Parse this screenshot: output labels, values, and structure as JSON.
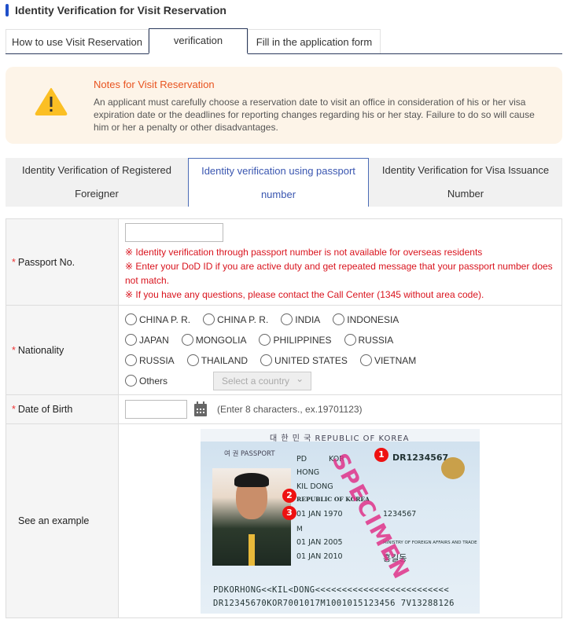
{
  "page_title": "Identity Verification for Visit Reservation",
  "tabs": [
    {
      "label": "How to use Visit Reservation"
    },
    {
      "label": "verification",
      "active": true
    },
    {
      "label": "Fill in the application form"
    }
  ],
  "notice": {
    "icon": "warning-icon",
    "title": "Notes for Visit Reservation",
    "body": "An applicant must carefully choose a reservation date to visit an office in consideration of his or her visa expiration date or the deadlines for reporting changes regarding his or her stay. Failure to do so will cause him or her a penalty or other disadvantages."
  },
  "subtabs": [
    {
      "line1": "Identity Verification of Registered",
      "line2": "Foreigner"
    },
    {
      "line1": "Identity verification using passport",
      "line2": "number",
      "active": true
    },
    {
      "line1": "Identity Verification for Visa Issuance",
      "line2": "Number"
    }
  ],
  "form": {
    "required_mark": "*",
    "passport": {
      "label": "Passport No.",
      "value": "",
      "notes": [
        "※ Identity verification through passport number is not available for overseas residents",
        "※ Enter your DoD ID if you are active duty and get repeated message that your passport number does not match.",
        "※ If you have any questions, please contact the Call Center (1345 without area code)."
      ]
    },
    "nationality": {
      "label": "Nationality",
      "rows": [
        [
          "CHINA P. R.",
          "CHINA P. R.",
          "INDIA",
          "INDONESIA"
        ],
        [
          "JAPAN",
          "MONGOLIA",
          "PHILIPPINES",
          "RUSSIA"
        ],
        [
          "RUSSIA",
          "THAILAND",
          "UNITED STATES",
          "VIETNAM"
        ]
      ],
      "others": "Others",
      "select_placeholder": "Select a country"
    },
    "dob": {
      "label": "Date of Birth",
      "value": "",
      "hint": "(Enter 8 characters., ex.19701123)"
    },
    "example": {
      "label": "See an example"
    }
  },
  "passport_example": {
    "header": "대 한 민 국   REPUBLIC OF KOREA",
    "doc": "여 권  PASSPORT",
    "type": "PD",
    "country": "KOR",
    "number": "DR1234567",
    "surname": "HONG",
    "given": "KIL DONG",
    "nationality": "REPUBLIC OF KOREA",
    "dob": "01 JAN 1970",
    "sex": "M",
    "issue": "01 JAN 2005",
    "expiry": "01 JAN 2010",
    "personal_no": "1234567",
    "authority": "MINISTRY OF FOREIGN AFFAIRS AND TRADE",
    "signature": "홍길동",
    "specimen": "SPECIMEN",
    "mrz1": "PDKORHONG<<KIL<DONG<<<<<<<<<<<<<<<<<<<<<<<<<",
    "mrz2": "DR12345670KOR7001017M1001015123456 7V13288126",
    "markers": [
      "1",
      "2",
      "3"
    ]
  }
}
